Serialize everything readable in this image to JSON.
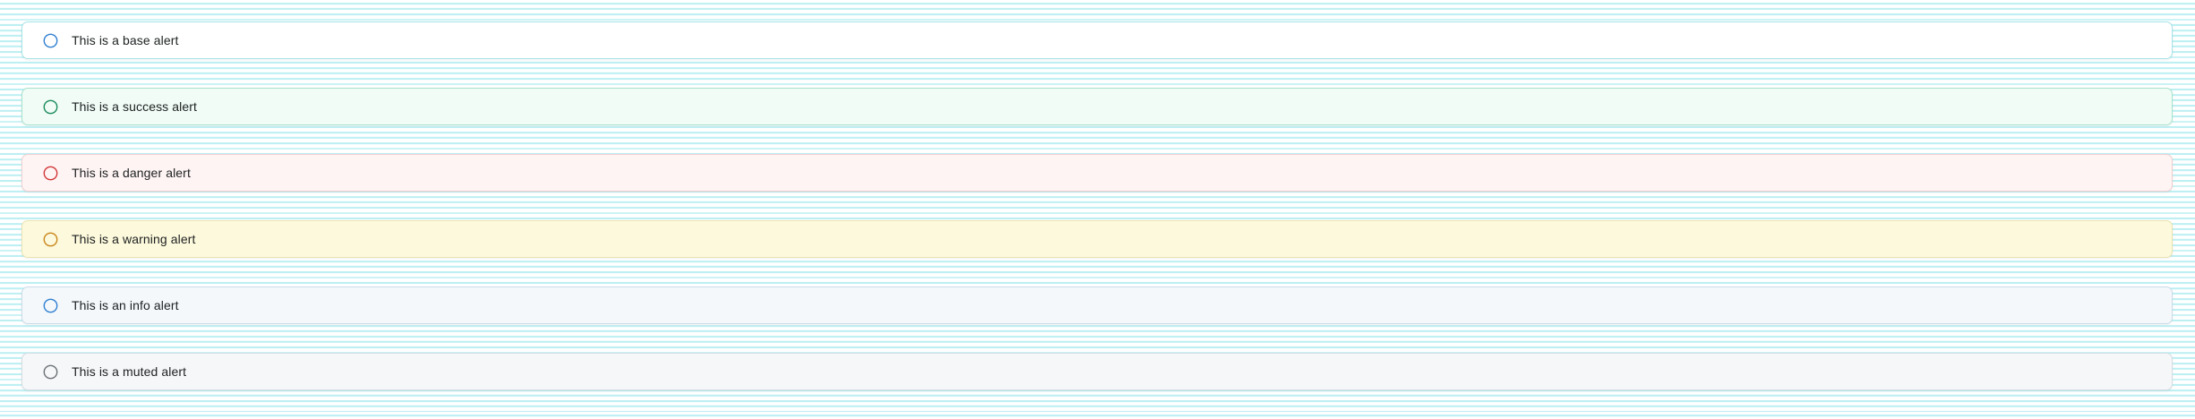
{
  "alerts": [
    {
      "variant": "base",
      "text": "This is a base alert",
      "icon": "circle-icon",
      "icon_color": "#2f7fd1"
    },
    {
      "variant": "success",
      "text": "This is a success alert",
      "icon": "circle-icon",
      "icon_color": "#1a8a5c"
    },
    {
      "variant": "danger",
      "text": "This is a danger alert",
      "icon": "circle-icon",
      "icon_color": "#d13838"
    },
    {
      "variant": "warning",
      "text": "This is a warning alert",
      "icon": "circle-icon",
      "icon_color": "#c9861a"
    },
    {
      "variant": "info",
      "text": "This is an info alert",
      "icon": "circle-icon",
      "icon_color": "#2f7fd1"
    },
    {
      "variant": "muted",
      "text": "This is a muted alert",
      "icon": "circle-icon",
      "icon_color": "#6b6f75"
    }
  ]
}
